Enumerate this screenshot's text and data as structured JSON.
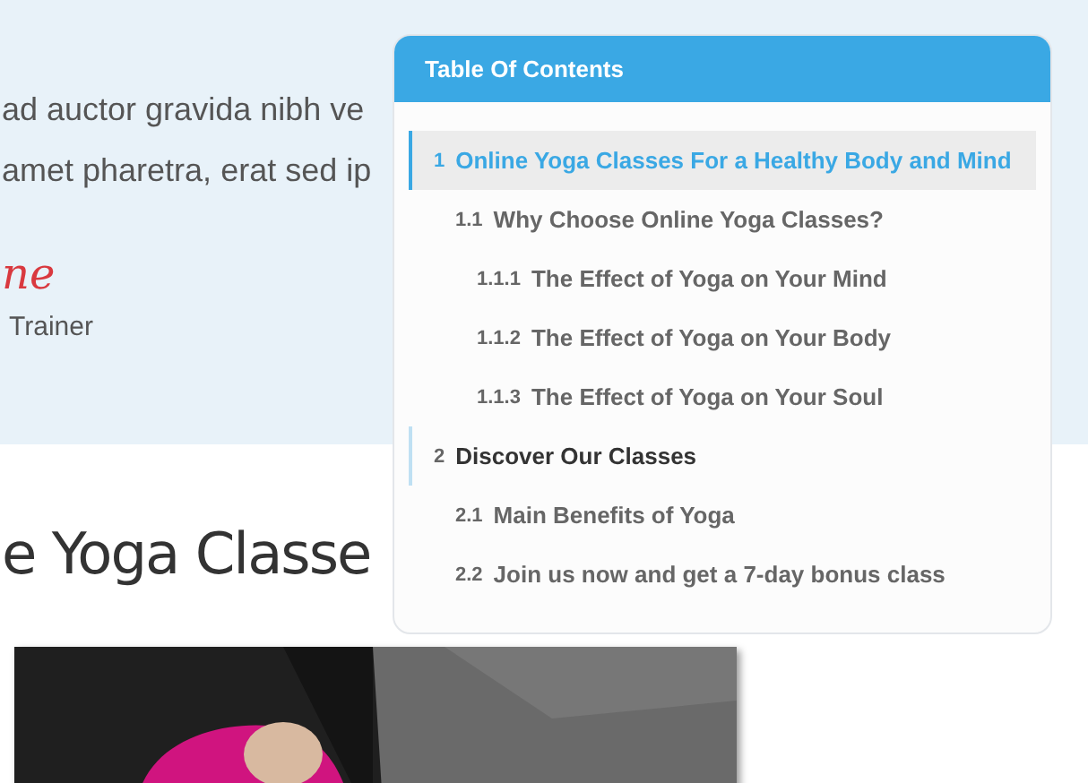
{
  "hero": {
    "paragraph_lines": [
      "ad auctor gravida nibh ve",
      "amet pharetra, erat sed ip"
    ],
    "signature": "ne",
    "role": "Trainer"
  },
  "section": {
    "heading": "e Yoga Classe"
  },
  "table_of_contents": {
    "title": "Table Of Contents",
    "items": [
      {
        "number": "1",
        "title": "Online Yoga Classes For a Healthy Body and Mind",
        "selected": true,
        "children": [
          {
            "number": "1.1",
            "title": "Why Choose Online Yoga Classes?",
            "selected": false,
            "children": [
              {
                "number": "1.1.1",
                "title": "The Effect of Yoga on Your Mind",
                "selected": false
              },
              {
                "number": "1.1.2",
                "title": "The Effect of Yoga on Your Body",
                "selected": false
              },
              {
                "number": "1.1.3",
                "title": "The Effect of Yoga on Your Soul",
                "selected": false
              }
            ]
          }
        ]
      },
      {
        "number": "2",
        "title": "Discover Our Classes",
        "selected": false,
        "children": [
          {
            "number": "2.1",
            "title": "Main Benefits of Yoga",
            "selected": false
          },
          {
            "number": "2.2",
            "title": "Join us now and get a 7-day bonus class",
            "selected": false
          }
        ]
      }
    ]
  }
}
